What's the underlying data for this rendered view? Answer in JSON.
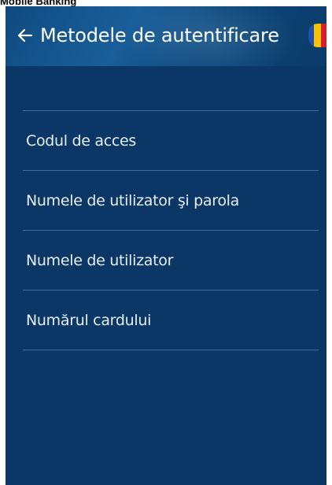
{
  "caption": "Mobile Banking",
  "header": {
    "title": "Metodele de autentificare",
    "back_icon": "arrow-left-icon",
    "flag_icon": "romania-flag-icon"
  },
  "menu": {
    "items": [
      {
        "label": "Codul de acces"
      },
      {
        "label": "Numele de utilizator şi parola"
      },
      {
        "label": "Numele de utilizator"
      },
      {
        "label": "Numărul cardului"
      }
    ]
  },
  "colors": {
    "background": "#0a3766",
    "header": "#1a5f9a",
    "divider": "#5a7fa6",
    "text": "#e8eef5",
    "flag_blue": "#1f4fb5",
    "flag_yellow": "#f5c400",
    "flag_red": "#d8202a"
  }
}
